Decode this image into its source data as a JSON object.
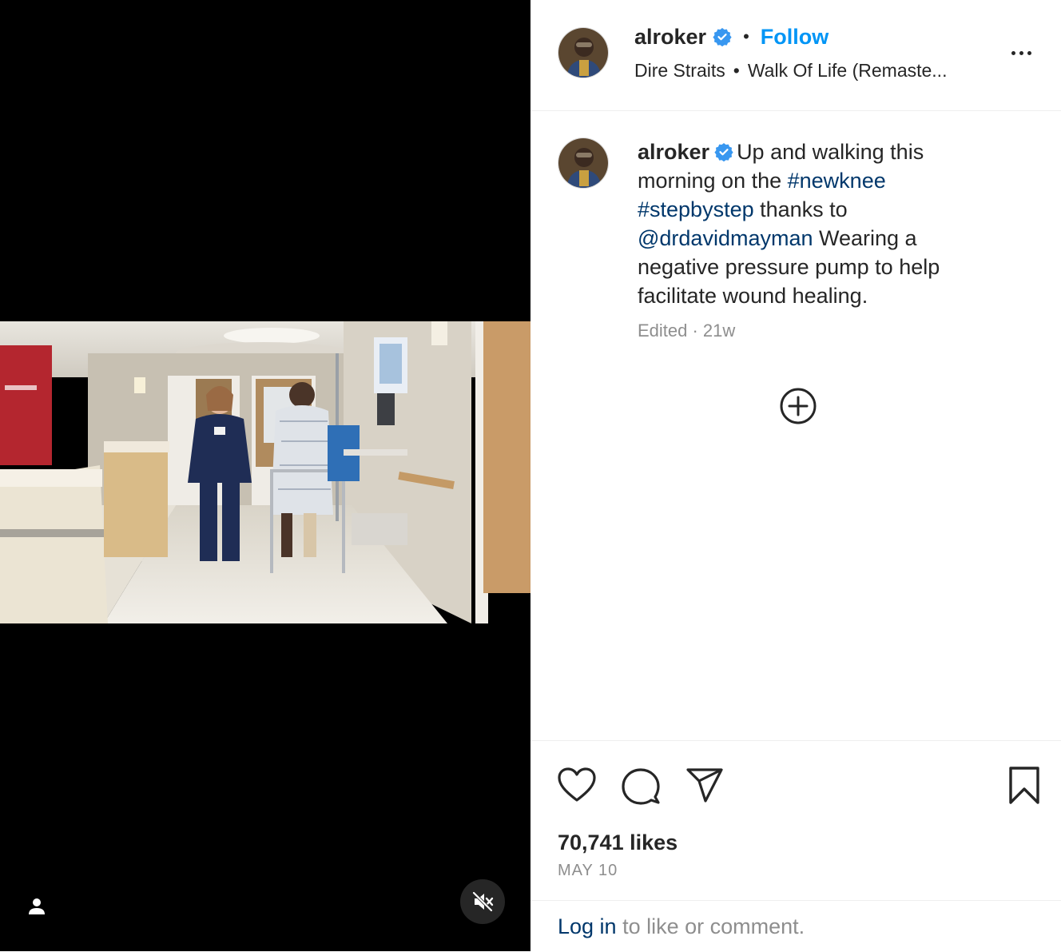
{
  "post": {
    "username": "alroker",
    "follow_label": "Follow",
    "separator": "•",
    "audio": {
      "artist": "Dire Straits",
      "track": "Walk Of Life (Remaste..."
    }
  },
  "caption": {
    "username": "alroker",
    "part1": "Up and walking this morning on the ",
    "hashtag1": "#newknee",
    "space1": " ",
    "hashtag2": "#stepbystep",
    "part2": " thanks to ",
    "mention": "@drdavidmayman",
    "part3": " Wearing a negative pressure pump to help facilitate wound healing.",
    "meta": "Edited · 21w"
  },
  "engagement": {
    "likes": "70,741 likes",
    "date": "MAY 10"
  },
  "login_prompt": {
    "link": "Log in",
    "text": " to like or comment."
  },
  "colors": {
    "accent": "#0095f6",
    "link": "#00376b",
    "secondary_text": "#8e8e8e",
    "verified": "#3897f0"
  },
  "icons": [
    "verified-badge-icon",
    "more-options-icon",
    "load-more-comments-icon",
    "heart-icon",
    "comment-icon",
    "share-icon",
    "bookmark-icon",
    "tag-user-icon",
    "muted-speaker-icon"
  ]
}
